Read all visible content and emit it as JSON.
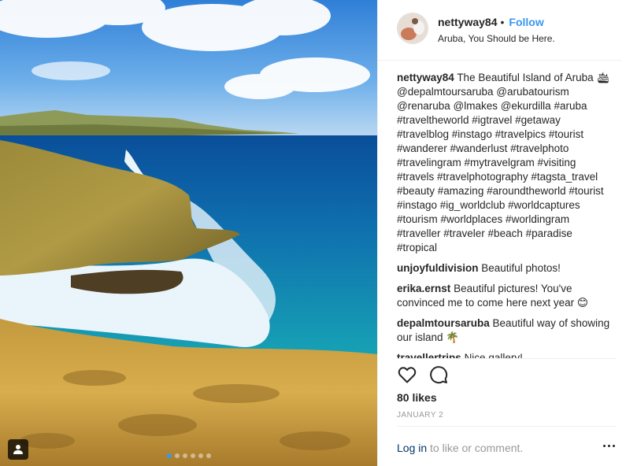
{
  "post": {
    "username": "nettyway84",
    "bullet": "•",
    "follow_label": "Follow",
    "location": "Aruba, You Should be Here.",
    "caption": "The Beautiful Island of Aruba 🛳 @depalmtoursaruba @arubatourism @renaruba @lmakes @ekurdilla #aruba #traveltheworld #igtravel #getaway #travelblog #instago #travelpics #tourist #wanderer #wanderlust #travelphoto #travelingram #mytravelgram #visiting #travels #travelphotography #tagsta_travel #beauty #amazing #aroundtheworld #tourist #instago #ig_worldclub #worldcaptures #tourism #worldplaces #worldingram #traveller #traveler #beach #paradise #tropical",
    "comments": [
      {
        "user": "unjoyfuldivision",
        "text": "Beautiful photos!"
      },
      {
        "user": "erika.ernst",
        "text": "Beautiful pictures! You've convinced me to come here next year 😊"
      },
      {
        "user": "depalmtoursaruba",
        "text": "Beautiful way of showing our island 🌴"
      },
      {
        "user": "travellertrips",
        "text": "Nice gallery!"
      }
    ],
    "likes": "80 likes",
    "date": "JANUARY 2",
    "login_label": "Log in",
    "comment_prompt": " to like or comment."
  },
  "icons": {
    "like": "heart-icon",
    "comment": "comment-bubble-icon",
    "tag": "user-tag-icon",
    "more": "more-options-icon"
  },
  "carousel": {
    "slides": 6,
    "active": 1
  },
  "colors": {
    "accent": "#3897f0",
    "link": "#003569",
    "muted": "#999999"
  }
}
